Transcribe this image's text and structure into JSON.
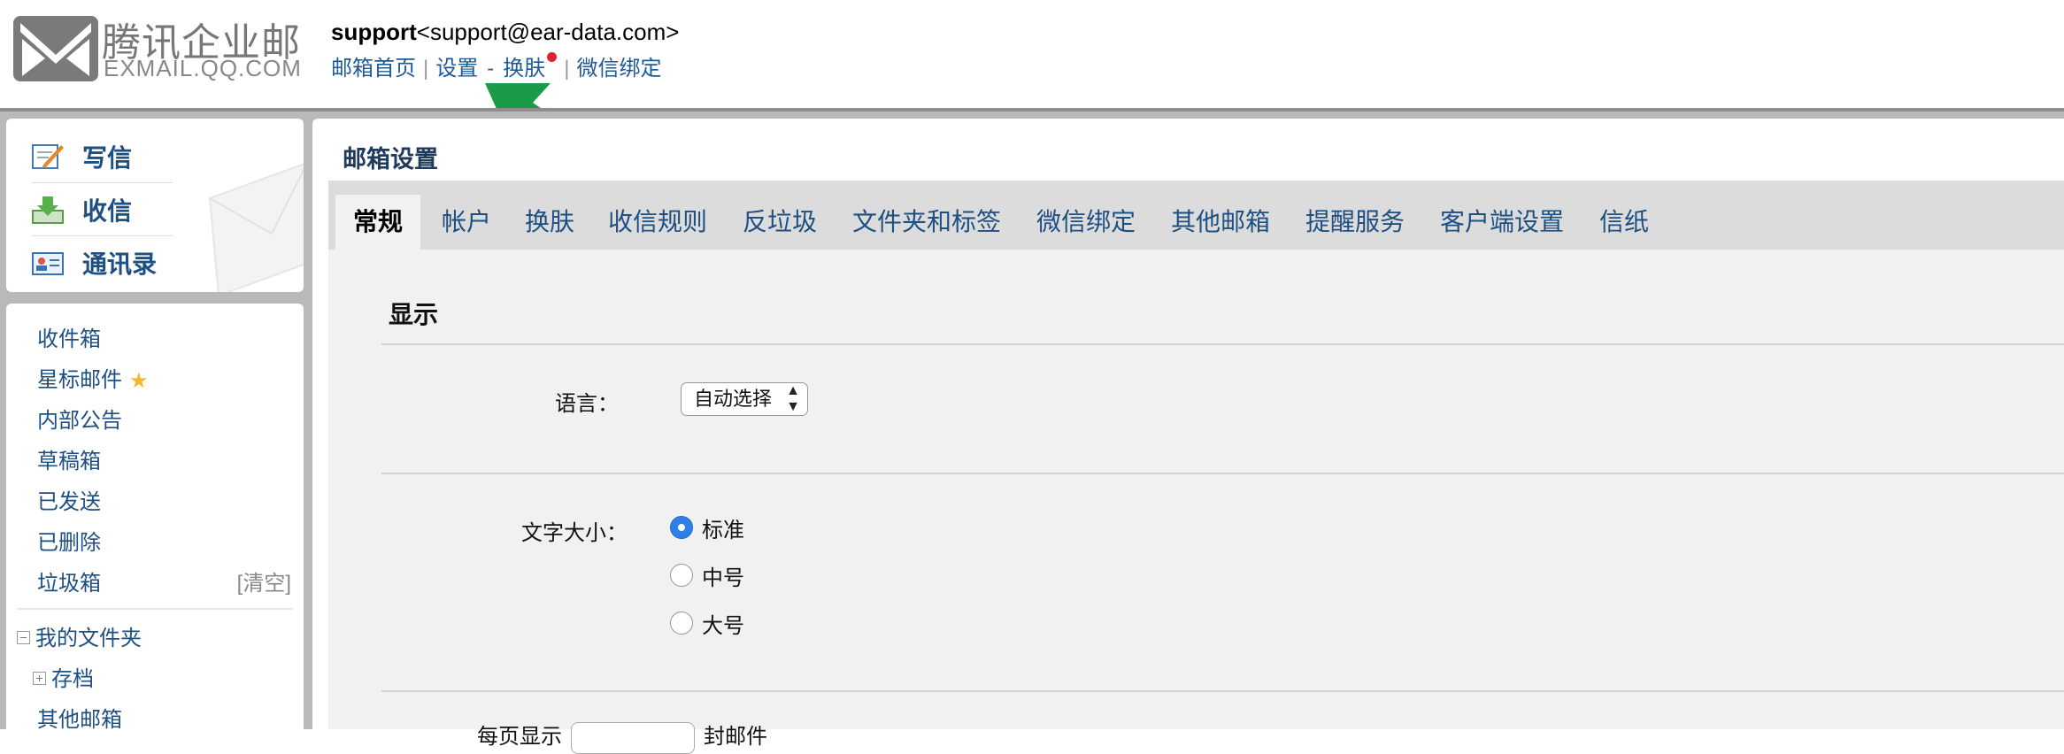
{
  "logo": {
    "cn": "腾讯企业邮",
    "en": "EXMAIL.QQ.COM"
  },
  "user": {
    "name": "support",
    "email": "<support@ear-data.com>"
  },
  "topnav": {
    "home": "邮箱首页",
    "settings": "设置",
    "dash": "-",
    "skin": "换肤",
    "wechat": "微信绑定"
  },
  "compose": {
    "write": "写信",
    "receive": "收信",
    "contacts": "通讯录"
  },
  "folders": {
    "inbox": "收件箱",
    "starred": "星标邮件",
    "notice": "内部公告",
    "drafts": "草稿箱",
    "sent": "已发送",
    "deleted": "已删除",
    "spam": "垃圾箱",
    "spam_clear": "[清空]",
    "my_folders": "我的文件夹",
    "archive": "存档",
    "other_mailboxes": "其他邮箱"
  },
  "main": {
    "title": "邮箱设置",
    "tabs": [
      "常规",
      "帐户",
      "换肤",
      "收信规则",
      "反垃圾",
      "文件夹和标签",
      "微信绑定",
      "其他邮箱",
      "提醒服务",
      "客户端设置",
      "信纸"
    ],
    "active_tab": "常规"
  },
  "display": {
    "section_title": "显示",
    "language_label": "语言：",
    "language_value": "自动选择",
    "font_size_label": "文字大小：",
    "font_options": [
      "标准",
      "中号",
      "大号"
    ],
    "font_selected": "标准",
    "cutoff_label": "每页显示",
    "cutoff_suffix": "封邮件"
  },
  "colors": {
    "link": "#1d4f82",
    "accent": "#2f7fe8",
    "arrow": "#1a9b47",
    "badge": "#dd2233"
  }
}
